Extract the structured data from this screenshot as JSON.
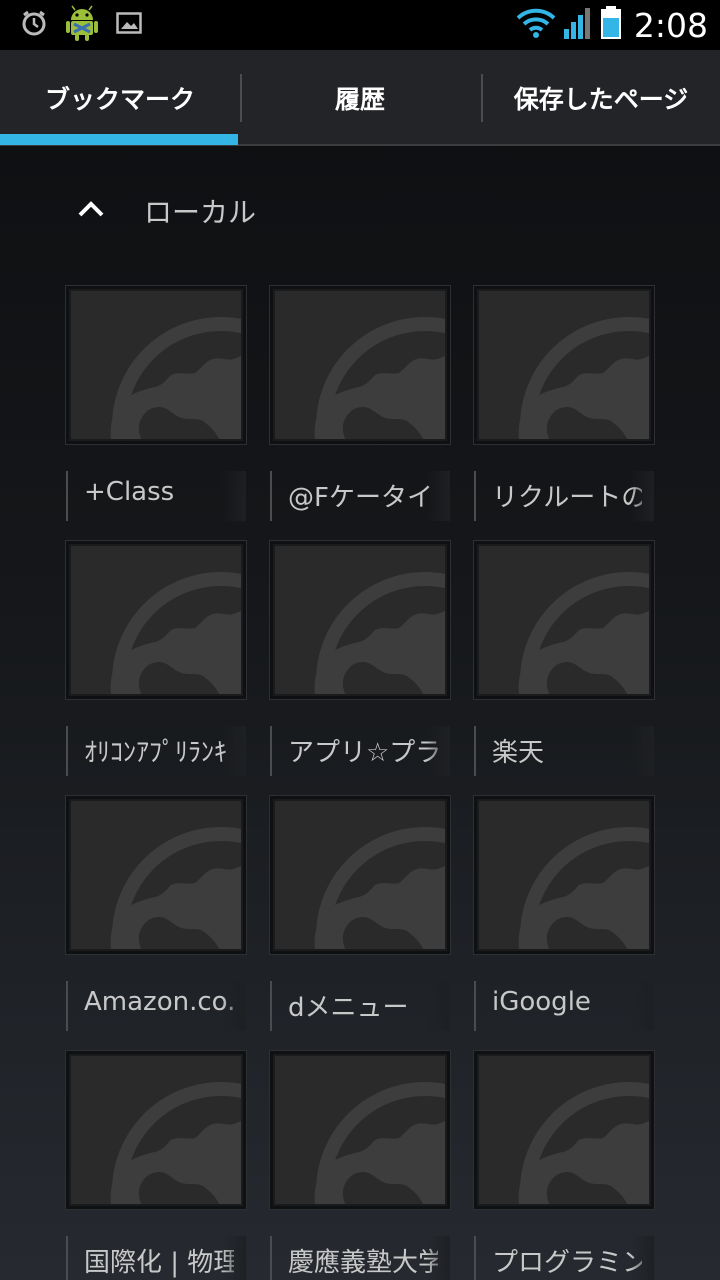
{
  "status_bar": {
    "icons": [
      "alarm-icon",
      "android-debug-icon",
      "image-icon",
      "wifi-icon",
      "signal-icon",
      "battery-icon"
    ],
    "time": "2:08"
  },
  "tabs": [
    {
      "label": "ブックマーク",
      "selected": true
    },
    {
      "label": "履歴",
      "selected": false
    },
    {
      "label": "保存したページ",
      "selected": false
    }
  ],
  "accent_color": "#33b5e5",
  "folder": {
    "icon": "chevron-up-icon",
    "label": "ローカル"
  },
  "bookmarks": [
    {
      "title": "+Class",
      "thumbnail": "globe-icon"
    },
    {
      "title": "@Fケータイ",
      "thumbnail": "globe-icon"
    },
    {
      "title": "リクルートの",
      "thumbnail": "globe-icon"
    },
    {
      "title": "ｵﾘｺﾝｱﾌﾟﾘﾗﾝｷ",
      "thumbnail": "globe-icon"
    },
    {
      "title": "アプリ☆プラ",
      "thumbnail": "globe-icon"
    },
    {
      "title": "楽天",
      "thumbnail": "globe-icon"
    },
    {
      "title": "Amazon.co.j",
      "thumbnail": "globe-icon"
    },
    {
      "title": "dメニュー",
      "thumbnail": "globe-icon"
    },
    {
      "title": "iGoogle",
      "thumbnail": "globe-icon"
    },
    {
      "title": "国際化 | 物理",
      "thumbnail": "globe-icon"
    },
    {
      "title": "慶應義塾大学",
      "thumbnail": "globe-icon"
    },
    {
      "title": "プログラミン",
      "thumbnail": "globe-icon"
    }
  ]
}
